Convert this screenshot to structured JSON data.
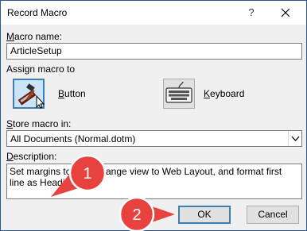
{
  "window": {
    "title": "Record Macro",
    "help_glyph": "?"
  },
  "macro_name": {
    "label_u": "M",
    "label_rest": "acro name:",
    "value": "ArticleSetup"
  },
  "assign": {
    "label": "Assign macro to",
    "button_label_u": "B",
    "button_label_rest": "utton",
    "keyboard_label_u": "K",
    "keyboard_label_rest": "eyboard"
  },
  "store": {
    "label_u": "S",
    "label_rest": "tore macro in:",
    "value": "All Documents (Normal.dotm)"
  },
  "description": {
    "label_u": "D",
    "label_rest": "escription:",
    "value": "Set margins to 0.5\", change view to Web Layout, and format first line as Heading 1"
  },
  "buttons": {
    "ok": "OK",
    "cancel": "Cancel"
  },
  "callouts": [
    "1",
    "2"
  ],
  "colors": {
    "callout_red": "#e8423f",
    "focus_blue": "#3c7fb1"
  }
}
